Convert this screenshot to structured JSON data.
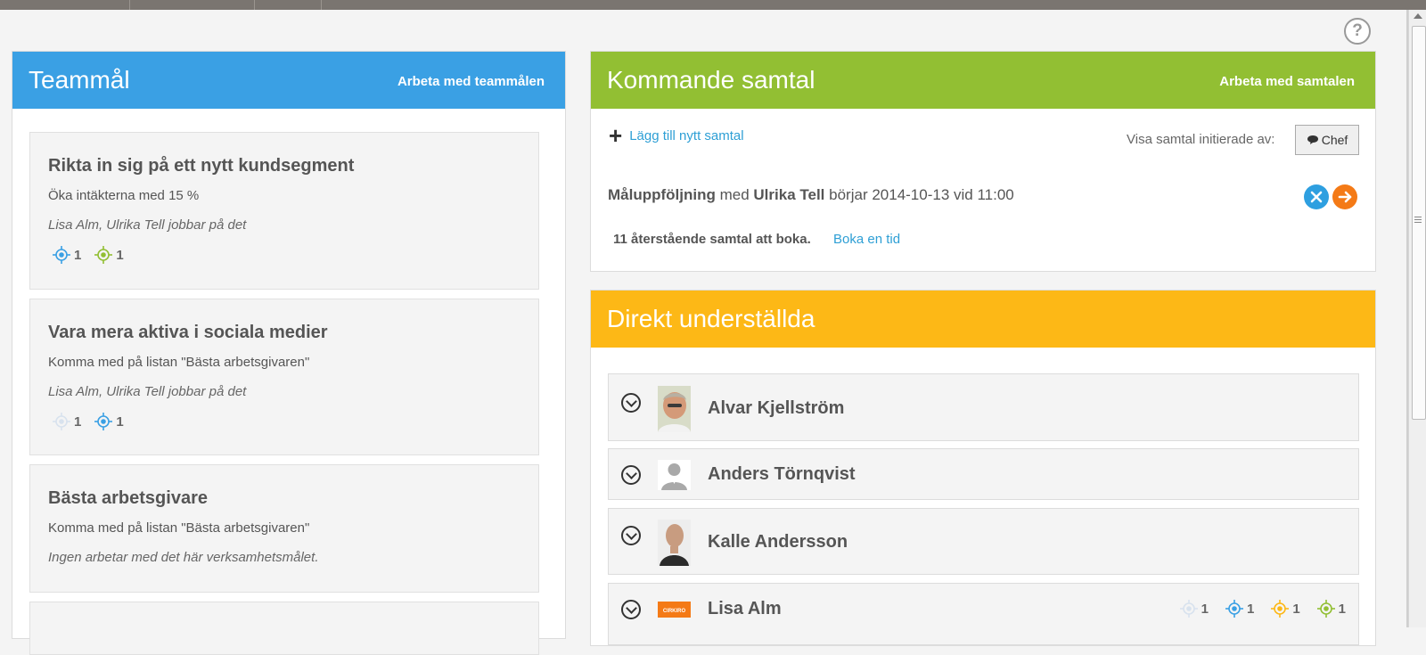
{
  "help_icon": "?",
  "teamgoals": {
    "title": "Teammål",
    "action": "Arbeta med teammålen",
    "goals": [
      {
        "title": "Rikta in sig på ett nytt kundsegment",
        "desc": "Öka intäkterna med 15 %",
        "who": "Lisa Alm, Ulrika Tell jobbar på det",
        "metrics": [
          {
            "icon": "target-icon",
            "color": "#3aa0e4",
            "value": "1"
          },
          {
            "icon": "target-icon",
            "color": "#92bf33",
            "value": "1"
          }
        ]
      },
      {
        "title": "Vara mera aktiva i sociala medier",
        "desc": "Komma med på listan \"Bästa arbetsgivaren\"",
        "who": "Lisa Alm, Ulrika Tell jobbar på det",
        "metrics": [
          {
            "icon": "target-icon",
            "color": "#d8e2ee",
            "value": "1"
          },
          {
            "icon": "target-icon",
            "color": "#3aa0e4",
            "value": "1"
          }
        ]
      },
      {
        "title": "Bästa arbetsgivare",
        "desc": "Komma med på listan \"Bästa arbetsgivaren\"",
        "who": "Ingen arbetar med det här verksamhetsmålet.",
        "metrics": []
      }
    ]
  },
  "samtal": {
    "title": "Kommande samtal",
    "action": "Arbeta med samtalen",
    "add_label": "Lägg till nytt samtal",
    "show_label": "Visa samtal initierade av:",
    "filter_button": "Chef",
    "meeting": {
      "type": "Måluppföljning",
      "with_word": "med",
      "person": "Ulrika Tell",
      "starts_text": "börjar 2014-10-13 vid 11:00"
    },
    "remaining_text": "11 återstående samtal att boka.",
    "book_label": "Boka en tid"
  },
  "reports": {
    "title": "Direkt underställda",
    "people": [
      {
        "name": "Alvar Kjellström",
        "avatar": "photo-avatar",
        "metrics": []
      },
      {
        "name": "Anders Törnqvist",
        "avatar": "default-avatar",
        "metrics": []
      },
      {
        "name": "Kalle Andersson",
        "avatar": "photo-avatar",
        "metrics": []
      },
      {
        "name": "Lisa Alm",
        "avatar": "logo-avatar",
        "avatar_text": "CIRKIRO",
        "metrics": [
          {
            "icon": "target-icon",
            "color": "#d8e2ee",
            "value": "1"
          },
          {
            "icon": "target-icon",
            "color": "#3aa0e4",
            "value": "1"
          },
          {
            "icon": "target-icon",
            "color": "#fdb816",
            "value": "1"
          },
          {
            "icon": "target-icon",
            "color": "#92bf33",
            "value": "1"
          }
        ]
      }
    ]
  }
}
